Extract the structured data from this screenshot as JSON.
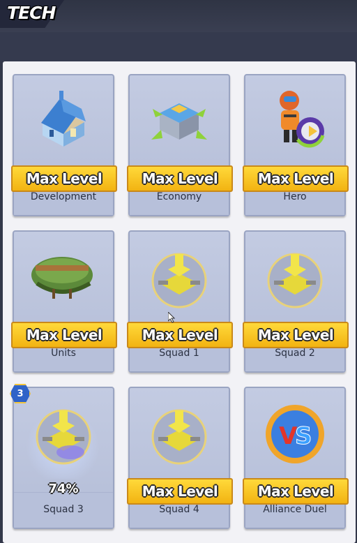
{
  "header": {
    "title": "TECH"
  },
  "cards": [
    {
      "name": "Development",
      "status": "Max Level",
      "icon": "house-icon"
    },
    {
      "name": "Economy",
      "status": "Max Level",
      "icon": "resource-building-icon"
    },
    {
      "name": "Hero",
      "status": "Max Level",
      "icon": "hero-icon"
    },
    {
      "name": "Units",
      "status": "Max Level",
      "icon": "military-helmet-icon"
    },
    {
      "name": "Squad 1",
      "status": "Max Level",
      "icon": "tank-icon"
    },
    {
      "name": "Squad 2",
      "status": "Max Level",
      "icon": "tank-icon"
    },
    {
      "name": "Squad 3",
      "progress": "74%",
      "badge": "3",
      "icon": "tank-icon"
    },
    {
      "name": "Squad 4",
      "status": "Max Level",
      "icon": "tank-icon"
    },
    {
      "name": "Alliance Duel",
      "status": "Max Level",
      "icon": "vs-icon"
    }
  ]
}
